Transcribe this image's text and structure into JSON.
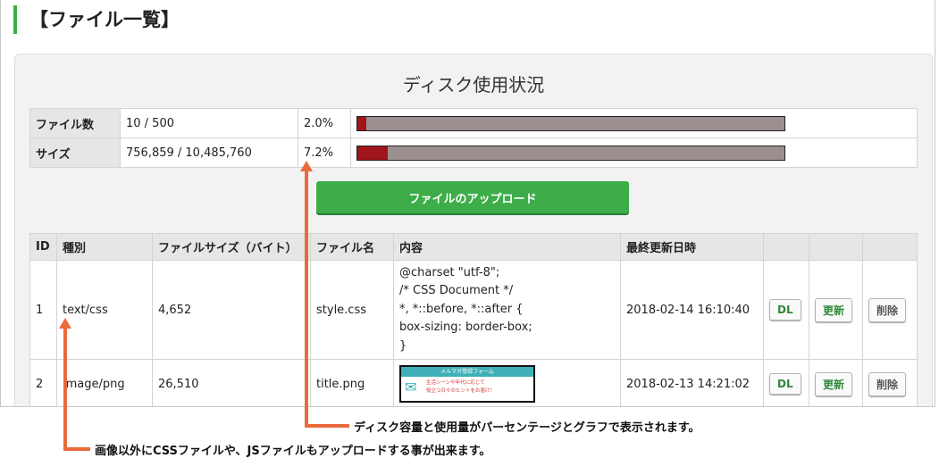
{
  "heading": "【ファイル一覧】",
  "disk": {
    "title": "ディスク使用状況",
    "rows": [
      {
        "label": "ファイル数",
        "value": "10 / 500",
        "percent": "2.0%",
        "fill": 0.02
      },
      {
        "label": "サイズ",
        "value": "756,859 / 10,485,760",
        "percent": "7.2%",
        "fill": 0.072
      }
    ]
  },
  "upload_label": "ファイルのアップロード",
  "columns": [
    "ID",
    "種別",
    "ファイルサイズ（バイト）",
    "ファイル名",
    "内容",
    "最終更新日時",
    "",
    "",
    ""
  ],
  "files": [
    {
      "id": "1",
      "type": "text/css",
      "size": "4,652",
      "name": "style.css",
      "content": [
        "@charset \"utf-8\";",
        "/* CSS Document */",
        "*, *::before, *::after {",
        "box-sizing: border-box;",
        "}"
      ],
      "updated": "2018-02-14 16:10:40"
    },
    {
      "id": "2",
      "type": "image/png",
      "size": "26,510",
      "name": "title.png",
      "thumb": {
        "band": "メルマガ登録フォーム",
        "caption1": "生活シーンや年代に応じて",
        "caption2": "役立つ日々のヒントをお届け！"
      },
      "updated": "2018-02-13 14:21:02"
    }
  ],
  "actions": {
    "download": "DL",
    "update": "更新",
    "delete": "削除"
  },
  "annotations": {
    "disk_note": "ディスク容量と使用量がパーセンテージとグラフで表示されます。",
    "type_note": "画像以外にCSSファイルや、JSファイルもアップロードする事が出来ます。"
  },
  "colors": {
    "accent": "#3cad48",
    "bar_fill": "#a0141b",
    "bar_bg": "#9c8f8f",
    "arrow": "#ea6a3b"
  }
}
